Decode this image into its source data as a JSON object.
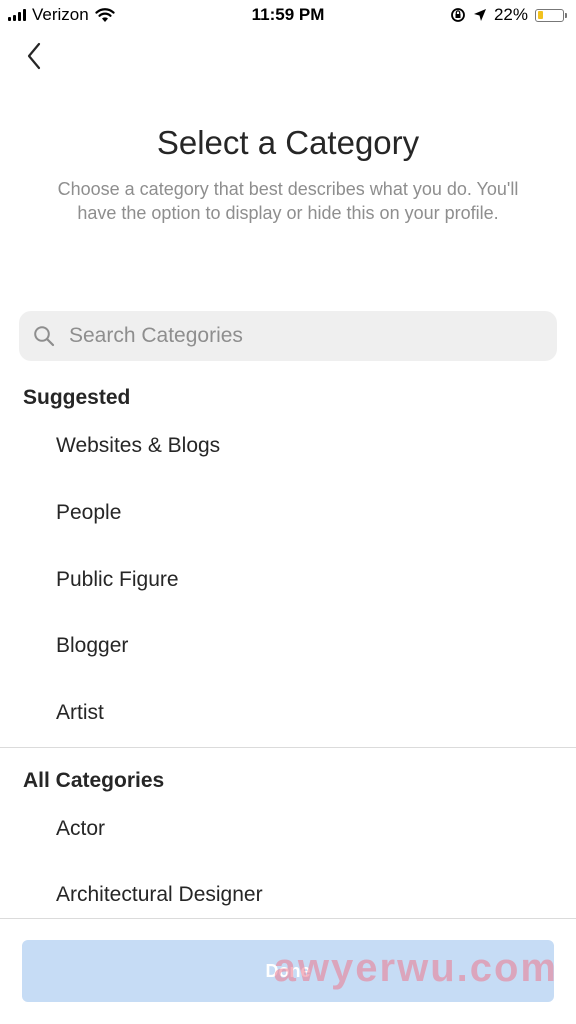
{
  "status_bar": {
    "carrier": "Verizon",
    "time": "11:59 PM",
    "battery_percent": "22%",
    "battery_level": 0.22,
    "battery_color": "#f2c21e",
    "icons": [
      "signal-icon",
      "wifi-icon",
      "orientation-lock-icon",
      "location-icon",
      "battery-icon"
    ]
  },
  "header": {
    "back_icon": "chevron-left-icon",
    "title": "Select a Category",
    "subtitle": "Choose a category that best describes what you do. You'll have the option to display or hide this on your profile."
  },
  "search": {
    "icon": "search-icon",
    "placeholder": "Search Categories",
    "value": ""
  },
  "suggested": {
    "label": "Suggested",
    "items": [
      "Websites & Blogs",
      "People",
      "Public Figure",
      "Blogger",
      "Artist"
    ]
  },
  "all_categories": {
    "label": "All Categories",
    "items": [
      "Actor",
      "Architectural Designer"
    ]
  },
  "footer": {
    "done_label": "Done",
    "done_color": "#c6dcf5"
  },
  "watermark": "awyerwu.com",
  "colors": {
    "text": "#262626",
    "secondary_text": "#8e8e8e",
    "search_bg": "#efefef",
    "divider": "#dbdbdb"
  }
}
